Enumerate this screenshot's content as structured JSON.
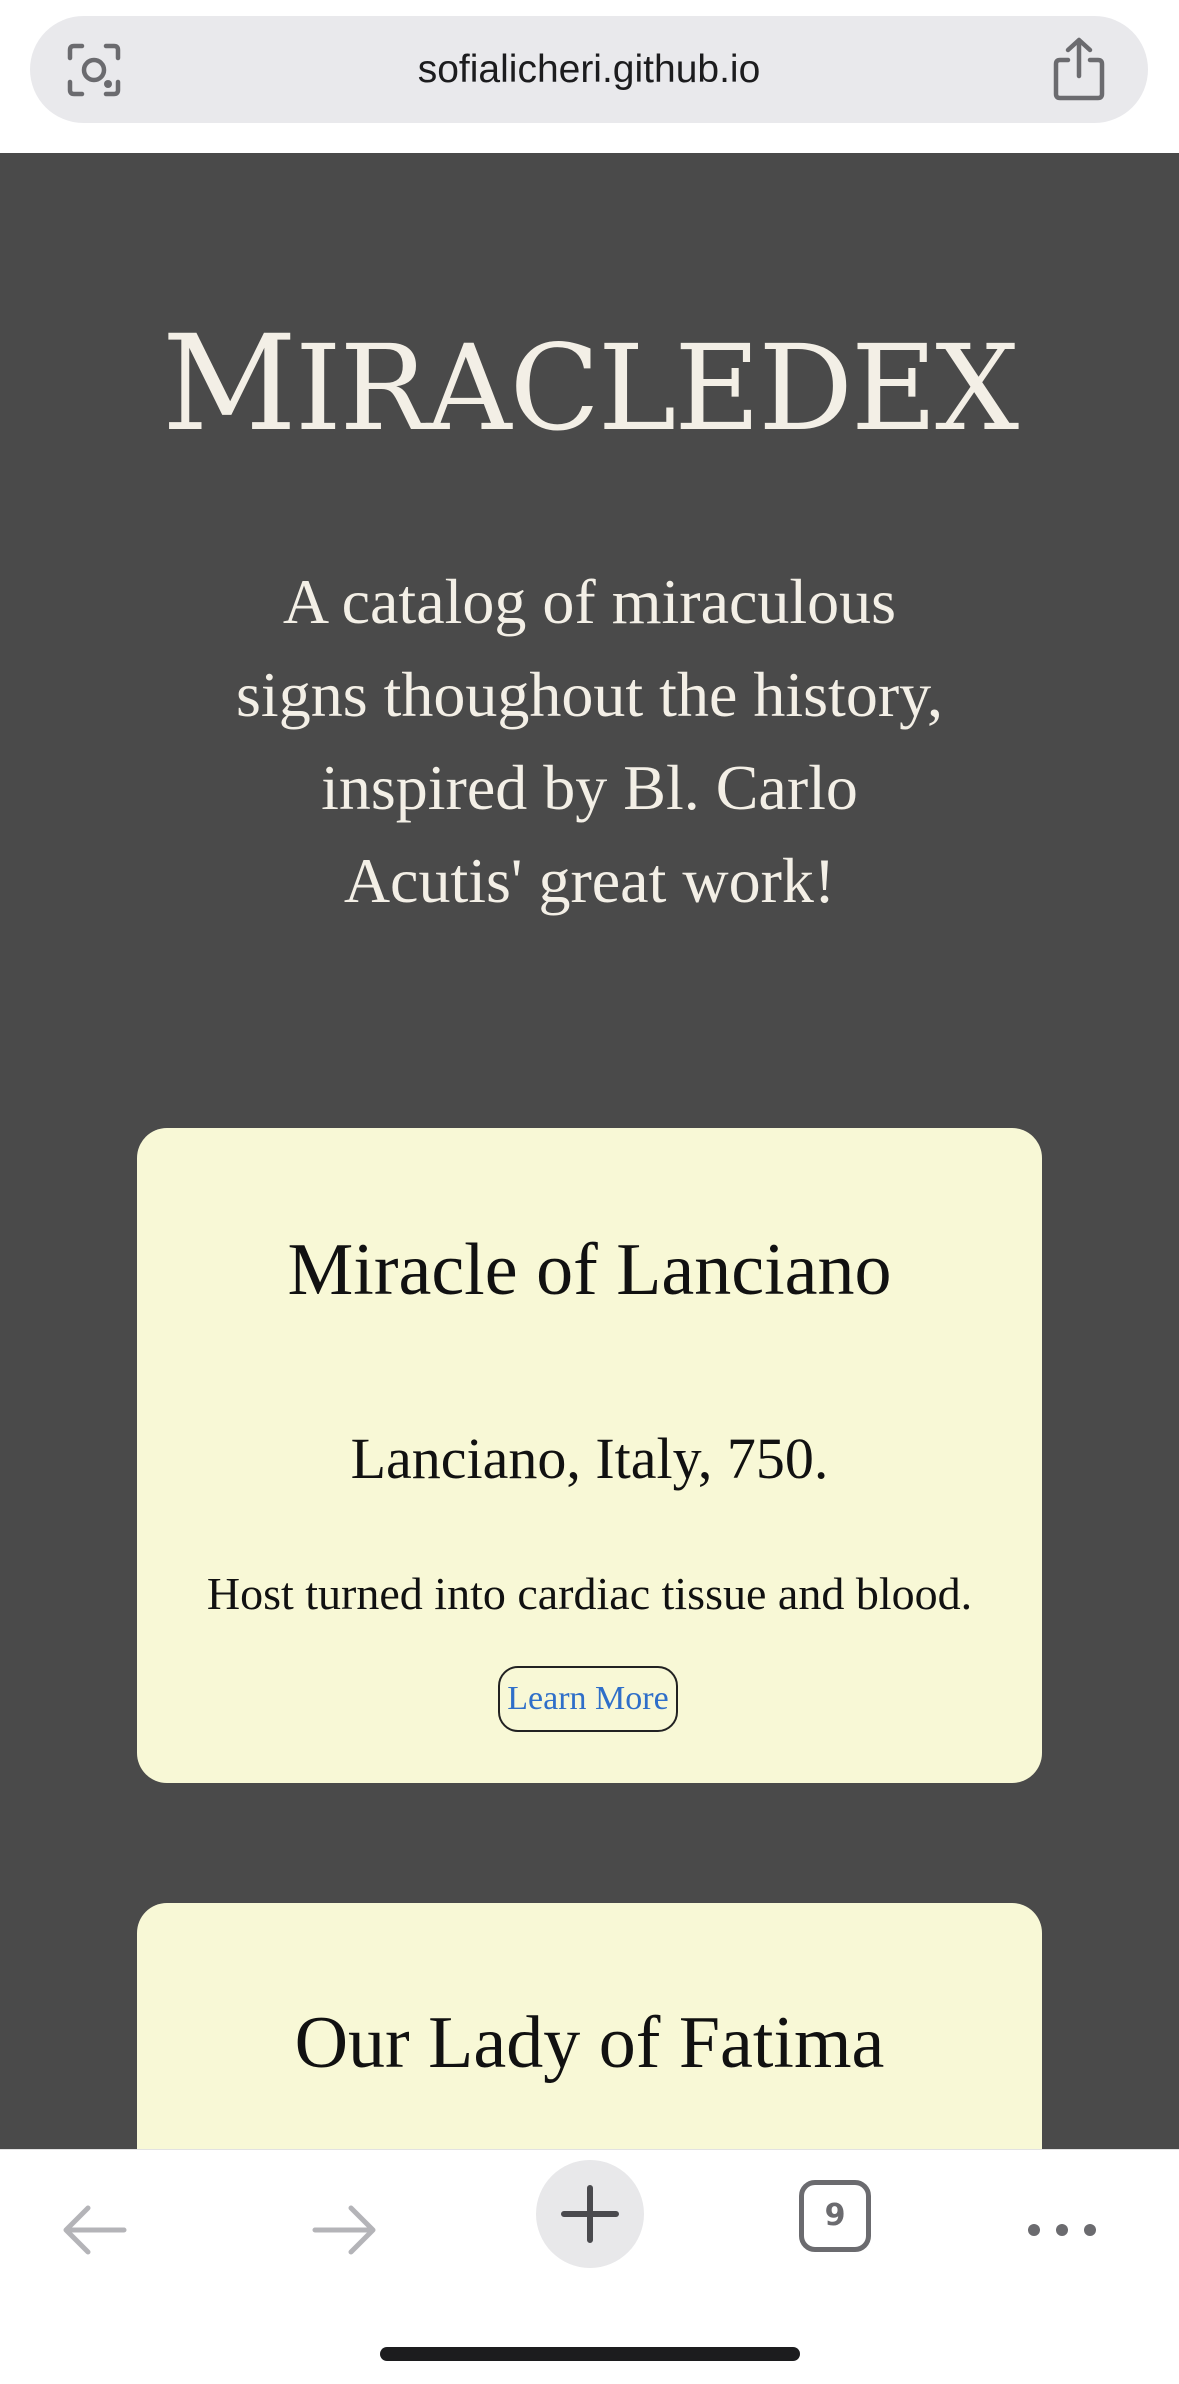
{
  "browser": {
    "url": "sofialicheri.github.io",
    "open_tabs_count": "9"
  },
  "header": {
    "title_first_letter": "M",
    "title_rest": "IRACLEDEX",
    "tagline": "A catalog of miraculous signs thoughout the history, inspired by Bl. Carlo Acutis' great work!"
  },
  "cards": [
    {
      "title": "Miracle of Lanciano",
      "location": "Lanciano, Italy, 750.",
      "description": "Host turned into cardiac tissue and blood.",
      "button_label": "Learn More"
    },
    {
      "title": "Our Lady of Fatima"
    }
  ],
  "icons": {
    "lens": "visual-search-icon",
    "share": "share-icon",
    "back": "back-arrow-icon",
    "forward": "forward-arrow-icon",
    "new_tab": "plus-icon",
    "tabs": "tabs-icon",
    "more": "more-icon"
  },
  "colors": {
    "page_background": "#4a4a4a",
    "card_background": "#f8f8d6",
    "title_color": "#f3efe6",
    "link_color": "#2f6fc9"
  }
}
